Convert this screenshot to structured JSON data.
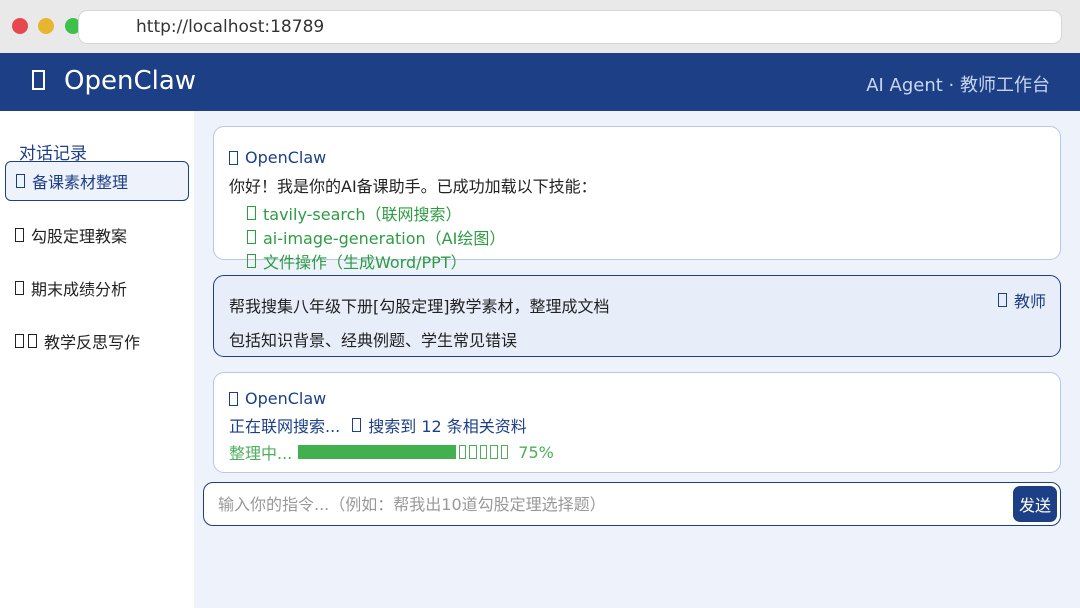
{
  "browser": {
    "url": "http://localhost:18789"
  },
  "header": {
    "title": "OpenClaw",
    "subtitle": "AI Agent · 教师工作台"
  },
  "sidebar": {
    "heading": "对话记录",
    "items": [
      {
        "label": "备课素材整理",
        "active": true
      },
      {
        "label": "勾股定理教案",
        "active": false
      },
      {
        "label": "期末成绩分析",
        "active": false
      },
      {
        "label": "教学反思写作",
        "active": false
      }
    ]
  },
  "messages": {
    "greeting": {
      "sender": "OpenClaw",
      "text": "你好！我是你的AI备课助手。已成功加载以下技能：",
      "skills": [
        "tavily-search（联网搜索）",
        "ai-image-generation（AI绘图）",
        "文件操作（生成Word/PPT）"
      ]
    },
    "user": {
      "sender": "教师",
      "line1": "帮我搜集八年级下册[勾股定理]教学素材，整理成文档",
      "line2": "包括知识背景、经典例题、学生常见错误"
    },
    "status": {
      "sender": "OpenClaw",
      "searching": "正在联网搜索...",
      "found": "搜索到 12 条相关资料",
      "organizing": "整理中...",
      "progress_percent": 75,
      "progress_label": "75%"
    }
  },
  "composer": {
    "placeholder": "输入你的指令...（例如：帮我出10道勾股定理选择题）",
    "send_label": "发送"
  },
  "colors": {
    "brand": "#1c3f85",
    "success": "#43b04f"
  }
}
